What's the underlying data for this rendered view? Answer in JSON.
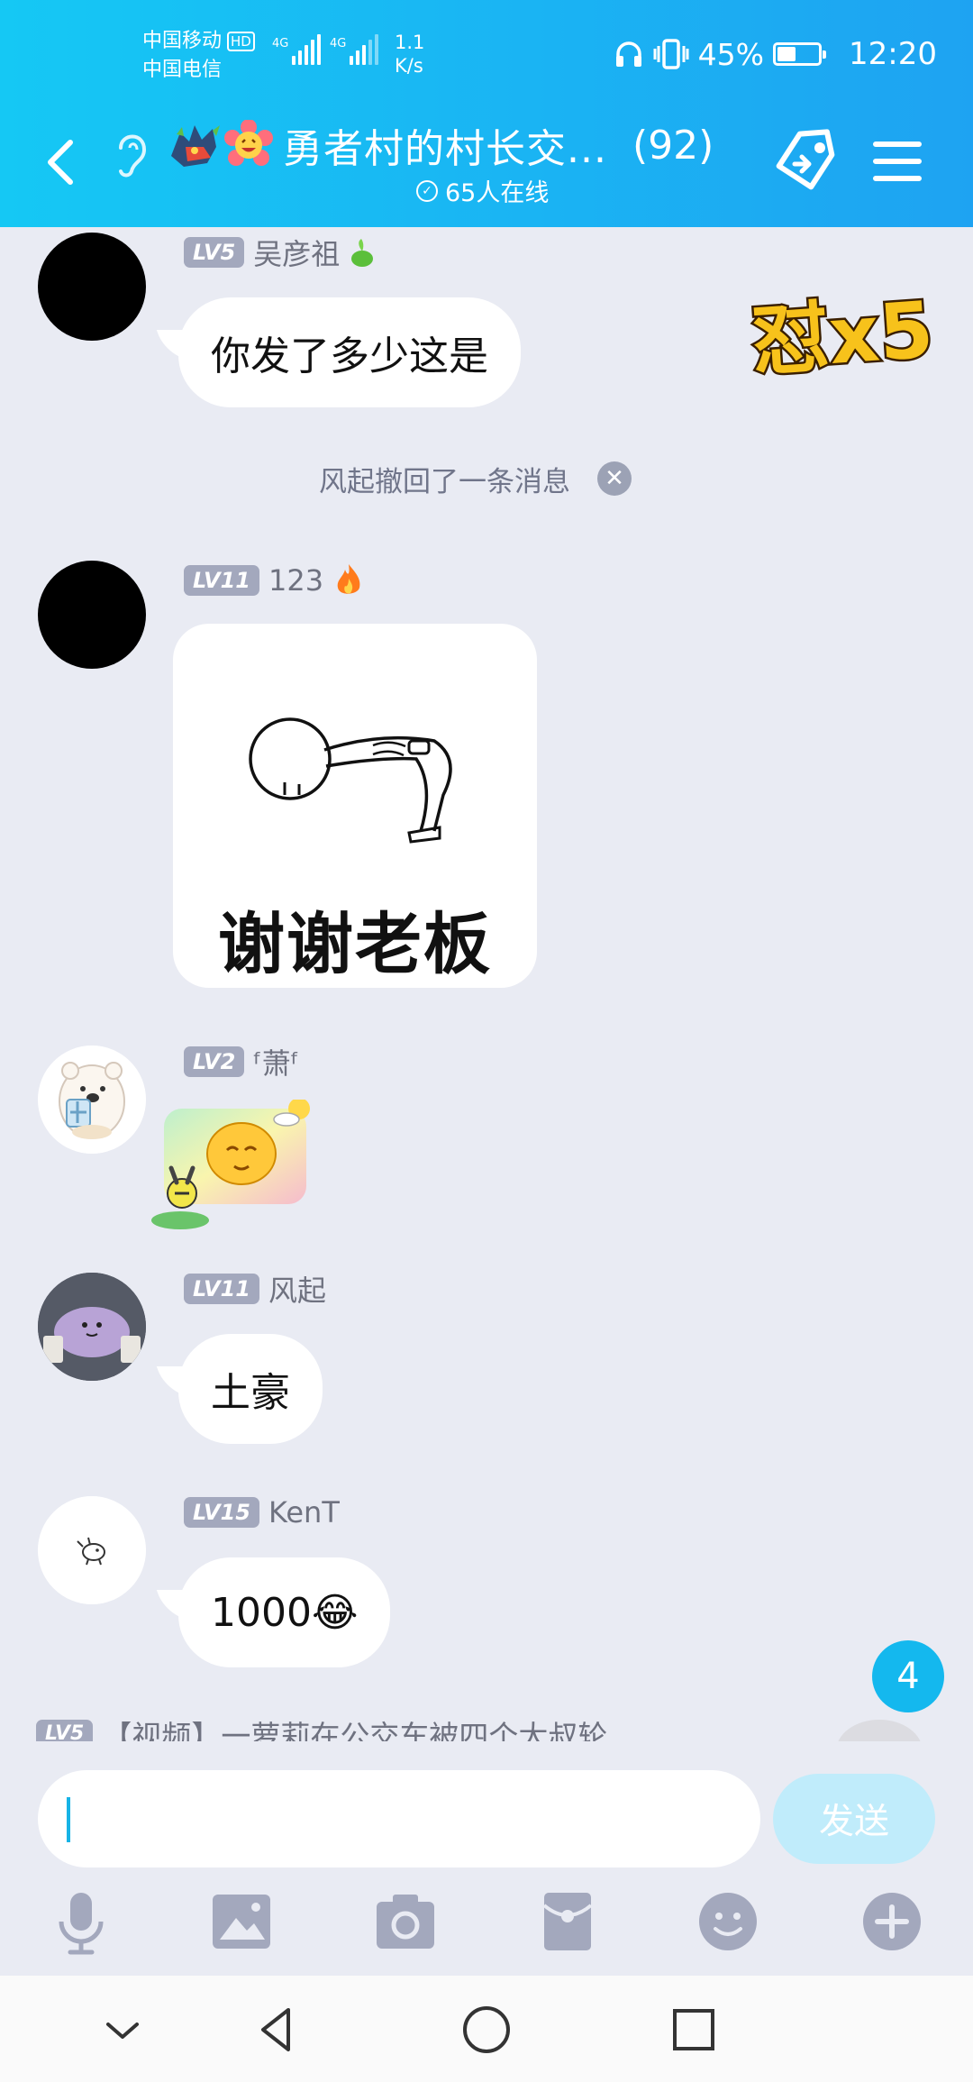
{
  "status": {
    "carrier1": "中国移动",
    "carrier1_badge": "HD",
    "carrier2": "中国电信",
    "net1": "4G",
    "net2": "4G",
    "speed_value": "1.1",
    "speed_unit": "K/s",
    "battery_percent": "45%",
    "battery_level": 0.45,
    "time": "12:20"
  },
  "header": {
    "title": "勇者村的村长交...",
    "member_count": "(92)",
    "online": "65人在线"
  },
  "messages": [
    {
      "level": "LV5",
      "nick": "吴彦祖",
      "text": "你发了多少这是"
    },
    {
      "level": "LV11",
      "nick": "123",
      "sticker_caption": "谢谢老板"
    },
    {
      "level": "LV2",
      "nick": "ᶠ萧ᶠ"
    },
    {
      "level": "LV11",
      "nick": "风起",
      "text": "土豪"
    },
    {
      "level": "LV15",
      "nick": "KenT",
      "text": "1000😂"
    }
  ],
  "recall_notice": "风起撤回了一条消息",
  "recall_close": "✕",
  "combo_badge": "怼x5",
  "new_badge_count": "4",
  "preview": {
    "level": "LV5",
    "text": "【视频】一萝莉在公交车被四个大叔轮..."
  },
  "composer": {
    "send_label": "发送"
  },
  "icons": {
    "back": "chevron-left-icon",
    "ear": "ear-icon",
    "tag": "tag-icon",
    "menu": "menu-icon",
    "voice": "microphone-icon",
    "image": "image-icon",
    "camera": "camera-icon",
    "red_packet": "red-packet-icon",
    "emoji": "emoji-icon",
    "plus": "plus-icon"
  },
  "colors": {
    "header_start": "#15c8f4",
    "header_end": "#1ea3f2",
    "badge": "#14b8ee",
    "send_disabled": "#c0ecfb",
    "chat_bg": "#e9ebf3"
  }
}
